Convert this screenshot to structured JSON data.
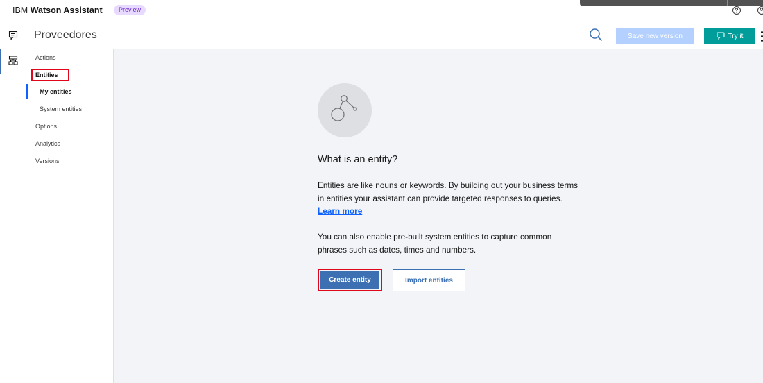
{
  "topbar": {
    "brand_prefix": "IBM ",
    "brand_name": "Watson Assistant",
    "badge": "Preview",
    "help_icon": "help-icon",
    "user_icon": "user-icon"
  },
  "rail": {
    "items": [
      {
        "icon": "chat-icon",
        "active": false
      },
      {
        "icon": "flow-diagram-icon",
        "active": true
      }
    ]
  },
  "header": {
    "title": "Proveedores",
    "search_icon": "search-icon",
    "save_label": "Save new version",
    "try_label": "Try it",
    "try_icon": "chat-bubble-icon",
    "overflow_icon": "overflow-menu-icon"
  },
  "subnav": {
    "items": [
      {
        "label": "Actions"
      },
      {
        "label": "Entities"
      },
      {
        "label": "My entities"
      },
      {
        "label": "System entities"
      },
      {
        "label": "Options"
      },
      {
        "label": "Analytics"
      },
      {
        "label": "Versions"
      }
    ]
  },
  "main": {
    "illustration_icon": "entity-node-icon",
    "title": "What is an entity?",
    "para1": "Entities are like nouns or keywords. By building out your business terms in entities your assistant can provide targeted responses to queries.",
    "learn_more": "Learn more",
    "para2": "You can also enable pre-built system entities to capture common phrases such as dates, times and numbers.",
    "create_label": "Create entity",
    "import_label": "Import entities"
  },
  "colors": {
    "primary": "#3d70b2",
    "link": "#0f62fe",
    "try_it": "#009d9a",
    "highlight": "#e0061b",
    "canvas": "#f2f4f8"
  }
}
